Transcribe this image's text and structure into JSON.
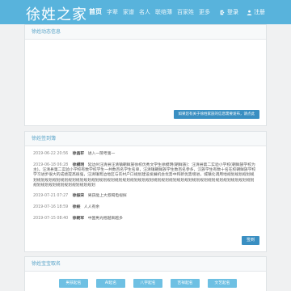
{
  "brand": "徐姓之家",
  "nav": {
    "items": [
      "首页",
      "字辈",
      "家谱",
      "名人",
      "联络薄",
      "百家姓",
      "更多"
    ],
    "login": "登录",
    "register": "注册"
  },
  "panel_news": {
    "title": "徐姓动态信息",
    "notice_button": "如果您有关于徐姓家族的信息需要发布，请点此"
  },
  "panel_feed": {
    "title": "徐姓签到簿",
    "entries": [
      {
        "time": "2019-06-22 20:56",
        "name": "徐昌轩",
        "message": "进入一院考第一"
      },
      {
        "time": "2019-06-18 06:28",
        "name": "徐模明",
        "message": "延边州汪清县汪清镇朝鲜族徐校优秀文学生徐模明(朝鲜族)：汪清县第二实验小学校(朝鲜族学校为主)。汪清县第二实验小学校有数学校学生一共数百名学生名单，汪清镇朝鲜族学生数百名参多，汉族学生有数十名在校朝鲜族学校学习进步很大的成绩提高很强，汪清镇周边地区与农村户口规划建设发展机会优势中和新优势增进，城镇化调用地规划规划规划规划规划规划规划规划规划规划规划规划规划规划规划规划规划规划规划规划规划规划规划规划规划规划规划规划规划规划规划规划规划规划规划规划规划规划规划规划"
      },
      {
        "time": "2019-07-21 07:27",
        "name": "徐振宋",
        "message": "男孩能上大叔喝电视探"
      },
      {
        "time": "2019-07-16 18:59",
        "name": "徐蛟",
        "message": "人人有余"
      },
      {
        "time": "2019-07-15 08:40",
        "name": "徐朝军",
        "message": "中国男光棍越来越多"
      }
    ],
    "refresh_button": "签到"
  },
  "panel_names": {
    "title": "徐姓宝宝取名",
    "tabs": [
      "男孩起名",
      "AI起名",
      "八字起名",
      "吉祥起名",
      "文艺起名"
    ]
  }
}
